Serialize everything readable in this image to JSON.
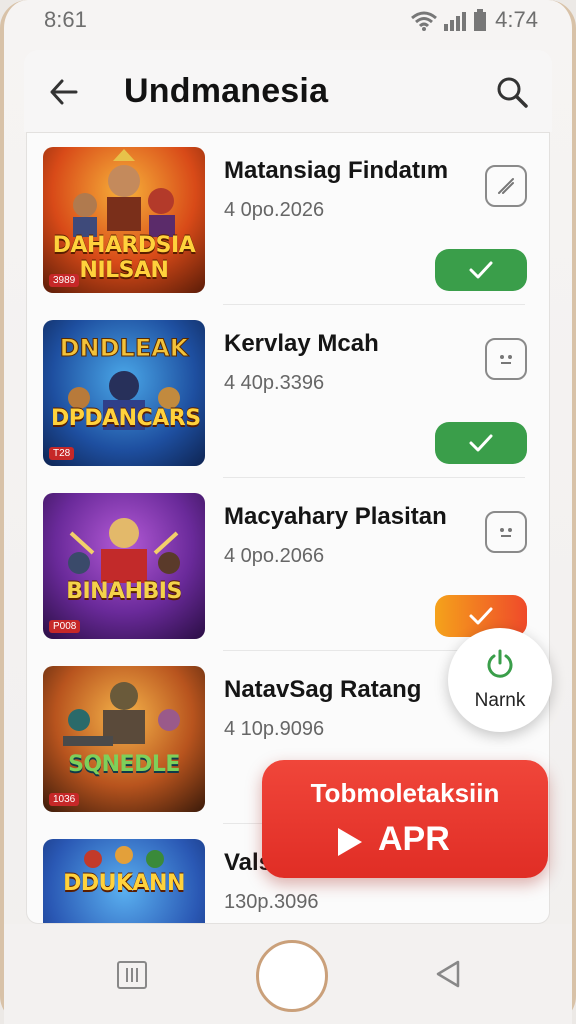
{
  "status": {
    "time": "8:61",
    "battery_time": "4:74"
  },
  "appbar": {
    "title": "Undmanesia"
  },
  "items": [
    {
      "name": "Matansiag Findatım",
      "meta": "4 0po.2026",
      "art": "DAHARDSIA NILSAN",
      "badge": "3989",
      "icon": "edit-icon"
    },
    {
      "name": "Kervlay Mcah",
      "meta": "4 40p.3396",
      "art": "DPDANCARS",
      "badge": "T28",
      "icon": "face-icon"
    },
    {
      "name": "Macyahary Plasitan",
      "meta": "4 0po.2066",
      "art": "BINAHBIS",
      "badge": "P008",
      "icon": "face-icon"
    },
    {
      "name": "NatavSag Ratang",
      "meta": "4 10p.9096",
      "art": "SQNEDLE",
      "badge": "1036",
      "icon": "none"
    },
    {
      "name": "Vals",
      "meta": "130p.3096",
      "art": "DDUKANN",
      "badge": "",
      "icon": "none"
    }
  ],
  "fab": {
    "label": "Narnk",
    "icon": "power-icon"
  },
  "cta": {
    "line1": "Tobmoletaksiin",
    "line2": "APR",
    "icon": "play-icon"
  },
  "colors": {
    "check_green": "#3a9e4a",
    "cta_red": "#e53a30",
    "accent_orange": "#f5a21b"
  }
}
